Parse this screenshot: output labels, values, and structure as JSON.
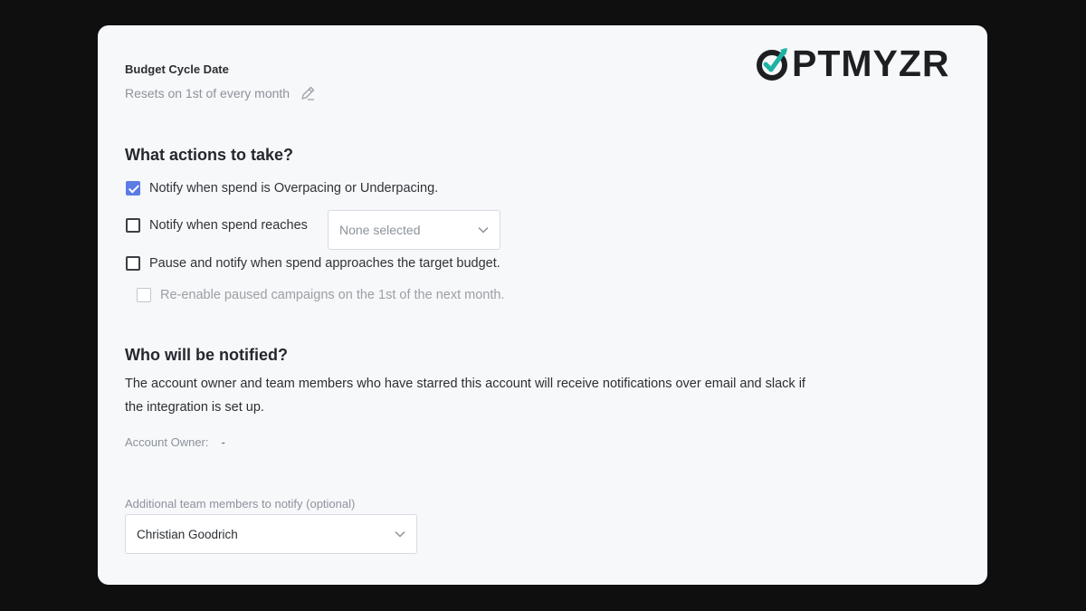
{
  "logo": {
    "text": "PTMYZR",
    "mark": "check-circle-logo-icon",
    "accent": "#1bb3a3"
  },
  "budget_cycle": {
    "title": "Budget Cycle Date",
    "value": "Resets on 1st of every month",
    "edit_icon": "pencil-icon"
  },
  "actions": {
    "title": "What actions to take?",
    "items": [
      {
        "label": "Notify when spend is Overpacing or Underpacing.",
        "checked": true
      },
      {
        "label": "Notify when spend reaches",
        "checked": false
      },
      {
        "label": "Pause and notify when spend approaches the target budget.",
        "checked": false
      },
      {
        "label": "Re-enable paused campaigns on the 1st of the next month.",
        "checked": false,
        "disabled": true
      }
    ],
    "spend_select": {
      "value": "None selected"
    }
  },
  "notify": {
    "title": "Who will be notified?",
    "description": "The account owner and team members who have starred this account will receive notifications over email and slack if the integration is set up.",
    "owner_label": "Account Owner:",
    "owner_value": "-",
    "team_label": "Additional team members to notify (optional)",
    "team_select": {
      "value": "Christian Goodrich"
    }
  },
  "colors": {
    "checkbox_checked": "#5b7ce6",
    "card_bg": "#f7f8fa",
    "page_bg": "#0f0f10"
  }
}
